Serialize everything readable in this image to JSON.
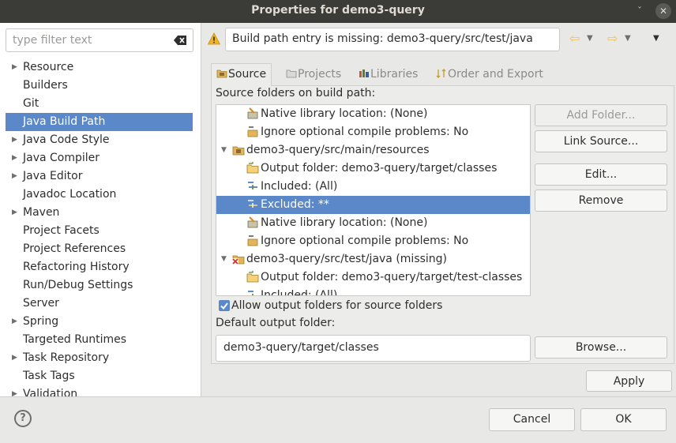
{
  "window": {
    "title": "Properties for demo3-query",
    "minimize_glyph": "ˇ",
    "close_glyph": "✕"
  },
  "filter": {
    "placeholder": "type filter text"
  },
  "nav_tree": [
    {
      "label": "Resource",
      "expandable": true
    },
    {
      "label": "Builders",
      "expandable": false
    },
    {
      "label": "Git",
      "expandable": false
    },
    {
      "label": "Java Build Path",
      "expandable": false,
      "selected": true
    },
    {
      "label": "Java Code Style",
      "expandable": true
    },
    {
      "label": "Java Compiler",
      "expandable": true
    },
    {
      "label": "Java Editor",
      "expandable": true
    },
    {
      "label": "Javadoc Location",
      "expandable": false
    },
    {
      "label": "Maven",
      "expandable": true
    },
    {
      "label": "Project Facets",
      "expandable": false
    },
    {
      "label": "Project References",
      "expandable": false
    },
    {
      "label": "Refactoring History",
      "expandable": false
    },
    {
      "label": "Run/Debug Settings",
      "expandable": false
    },
    {
      "label": "Server",
      "expandable": false
    },
    {
      "label": "Spring",
      "expandable": true
    },
    {
      "label": "Targeted Runtimes",
      "expandable": false
    },
    {
      "label": "Task Repository",
      "expandable": true
    },
    {
      "label": "Task Tags",
      "expandable": false
    },
    {
      "label": "Validation",
      "expandable": true
    }
  ],
  "message": {
    "text": "Build path entry is missing: demo3-query/src/test/java"
  },
  "tabs": [
    {
      "label": "Source",
      "active": true
    },
    {
      "label": "Projects",
      "active": false
    },
    {
      "label": "Libraries",
      "active": false
    },
    {
      "label": "Order and Export",
      "active": false
    }
  ],
  "source": {
    "section_label": "Source folders on build path:",
    "entries": [
      {
        "text": "Native library location: (None)",
        "icon": "native-lib-icon",
        "level": 1
      },
      {
        "text": "Ignore optional compile problems: No",
        "icon": "ignore-problems-icon",
        "level": 1
      },
      {
        "text": "demo3-query/src/main/resources",
        "icon": "source-folder-icon",
        "level": 0,
        "expanded": true
      },
      {
        "text": "Output folder: demo3-query/target/classes",
        "icon": "output-folder-icon",
        "level": 1
      },
      {
        "text": "Included: (All)",
        "icon": "included-icon",
        "level": 1
      },
      {
        "text": "Excluded: **",
        "icon": "excluded-icon",
        "level": 1,
        "selected": true
      },
      {
        "text": "Native library location: (None)",
        "icon": "native-lib-icon",
        "level": 1
      },
      {
        "text": "Ignore optional compile problems: No",
        "icon": "ignore-problems-icon",
        "level": 1
      },
      {
        "text": "demo3-query/src/test/java (missing)",
        "icon": "missing-source-folder-icon",
        "level": 0,
        "expanded": true
      },
      {
        "text": "Output folder: demo3-query/target/test-classes",
        "icon": "output-folder-icon",
        "level": 1
      },
      {
        "text": "Included: (All)",
        "icon": "included-icon",
        "level": 1
      }
    ],
    "buttons": {
      "add_folder": "Add Folder...",
      "link_source": "Link Source...",
      "edit": "Edit...",
      "remove": "Remove"
    },
    "allow_output_folders": {
      "label": "Allow output folders for source folders",
      "checked": true
    },
    "default_output": {
      "label": "Default output folder:",
      "value": "demo3-query/target/classes"
    },
    "browse": "Browse..."
  },
  "apply": "Apply",
  "footer": {
    "help_glyph": "?",
    "cancel": "Cancel",
    "ok": "OK"
  },
  "colors": {
    "selection": "#5a88c8",
    "titlebar": "#3b3b38",
    "warning": "#f0b429"
  }
}
